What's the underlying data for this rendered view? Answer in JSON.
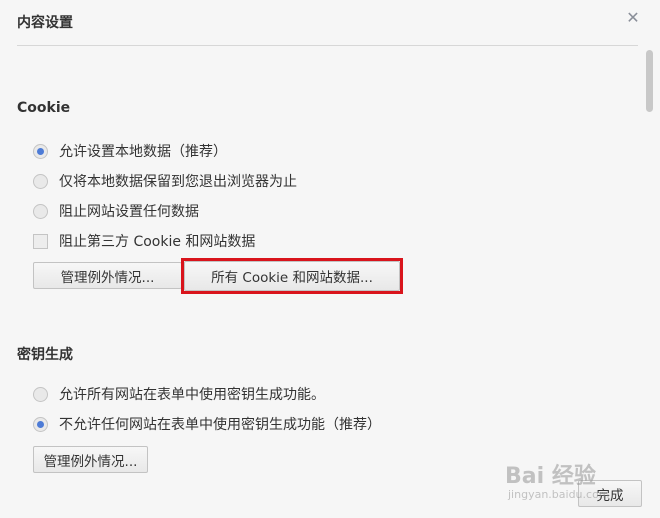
{
  "dialog": {
    "title": "内容设置",
    "close_glyph": "✕"
  },
  "cookie": {
    "section_title": "Cookie",
    "options": [
      {
        "label": "允许设置本地数据（推荐）",
        "type": "radio",
        "checked": true
      },
      {
        "label": "仅将本地数据保留到您退出浏览器为止",
        "type": "radio",
        "checked": false
      },
      {
        "label": "阻止网站设置任何数据",
        "type": "radio",
        "checked": false
      },
      {
        "label": "阻止第三方 Cookie 和网站数据",
        "type": "checkbox",
        "checked": false
      }
    ],
    "manage_exceptions_label": "管理例外情况...",
    "all_cookies_label": "所有 Cookie 和网站数据..."
  },
  "keygen": {
    "section_title": "密钥生成",
    "options": [
      {
        "label": "允许所有网站在表单中使用密钥生成功能。",
        "type": "radio",
        "checked": false
      },
      {
        "label": "不允许任何网站在表单中使用密钥生成功能（推荐）",
        "type": "radio",
        "checked": true
      }
    ],
    "manage_exceptions_label": "管理例外情况..."
  },
  "footer": {
    "done_label": "完成"
  },
  "watermark": {
    "brand": "Bai 经验",
    "url": "jingyan.baidu.com"
  },
  "colors": {
    "accent": "#4d7bd6",
    "highlight": "#d9141c"
  }
}
